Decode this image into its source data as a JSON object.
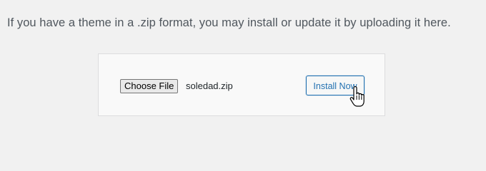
{
  "instructions": {
    "text": "If you have a theme in a .zip format, you may install or update it by uploading it here."
  },
  "upload_form": {
    "choose_file_label": "Choose File",
    "selected_file": "soledad.zip",
    "install_label": "Install Now"
  },
  "cursor": {
    "icon": "hand-pointer-icon"
  },
  "colors": {
    "page_background": "#f1f1f1",
    "box_background": "#f9f9f9",
    "box_border": "#dcdcde",
    "text": "#50575e",
    "accent": "#2271b1"
  }
}
